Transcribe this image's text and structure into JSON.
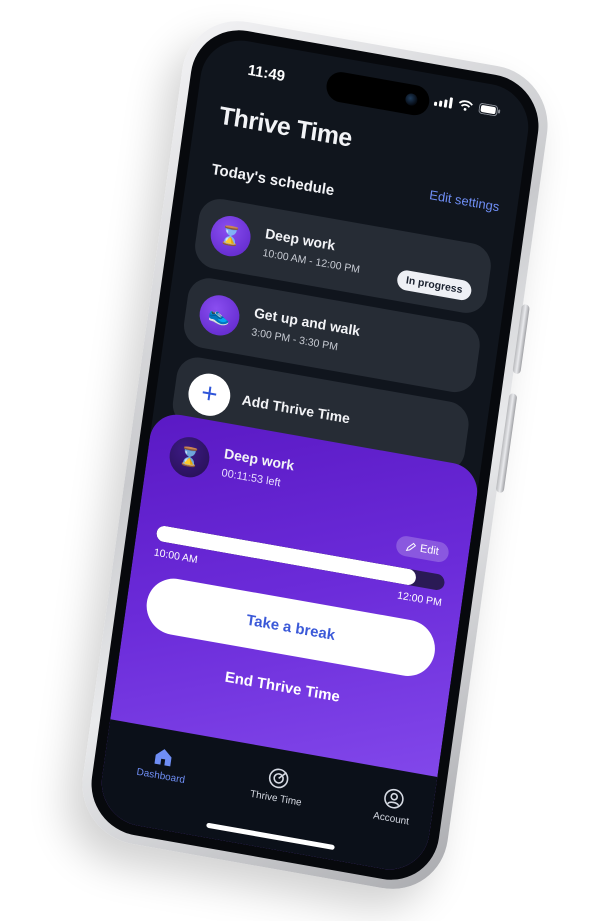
{
  "status_bar": {
    "time": "11:49"
  },
  "app": {
    "title": "Thrive Time"
  },
  "header": {
    "edit_settings": "Edit settings"
  },
  "schedule": {
    "title": "Today's schedule",
    "items": [
      {
        "title": "Deep work",
        "time": "10:00 AM - 12:00 PM",
        "badge": "In progress",
        "icon": "hourglass-icon"
      },
      {
        "title": "Get up and walk",
        "time": "3:00 PM - 3:30 PM",
        "icon": "sneaker-icon"
      }
    ],
    "add_label": "Add Thrive Time"
  },
  "active_session": {
    "title": "Deep work",
    "remaining": "00:11:53 left",
    "edit_label": "Edit",
    "start_time": "10:00 AM",
    "end_time": "12:00 PM",
    "progress_fraction": 0.9,
    "break_label": "Take a break",
    "end_label": "End Thrive Time"
  },
  "tabbar": {
    "tabs": [
      {
        "label": "Dashboard",
        "icon": "home-icon",
        "active": true
      },
      {
        "label": "Thrive Time",
        "icon": "target-icon",
        "active": false
      },
      {
        "label": "Account",
        "icon": "user-icon",
        "active": false
      }
    ]
  },
  "colors": {
    "accent": "#6f8ef5",
    "purple": "#6b2bd9",
    "card": "#262c35",
    "screen_bg": "#10151d"
  }
}
